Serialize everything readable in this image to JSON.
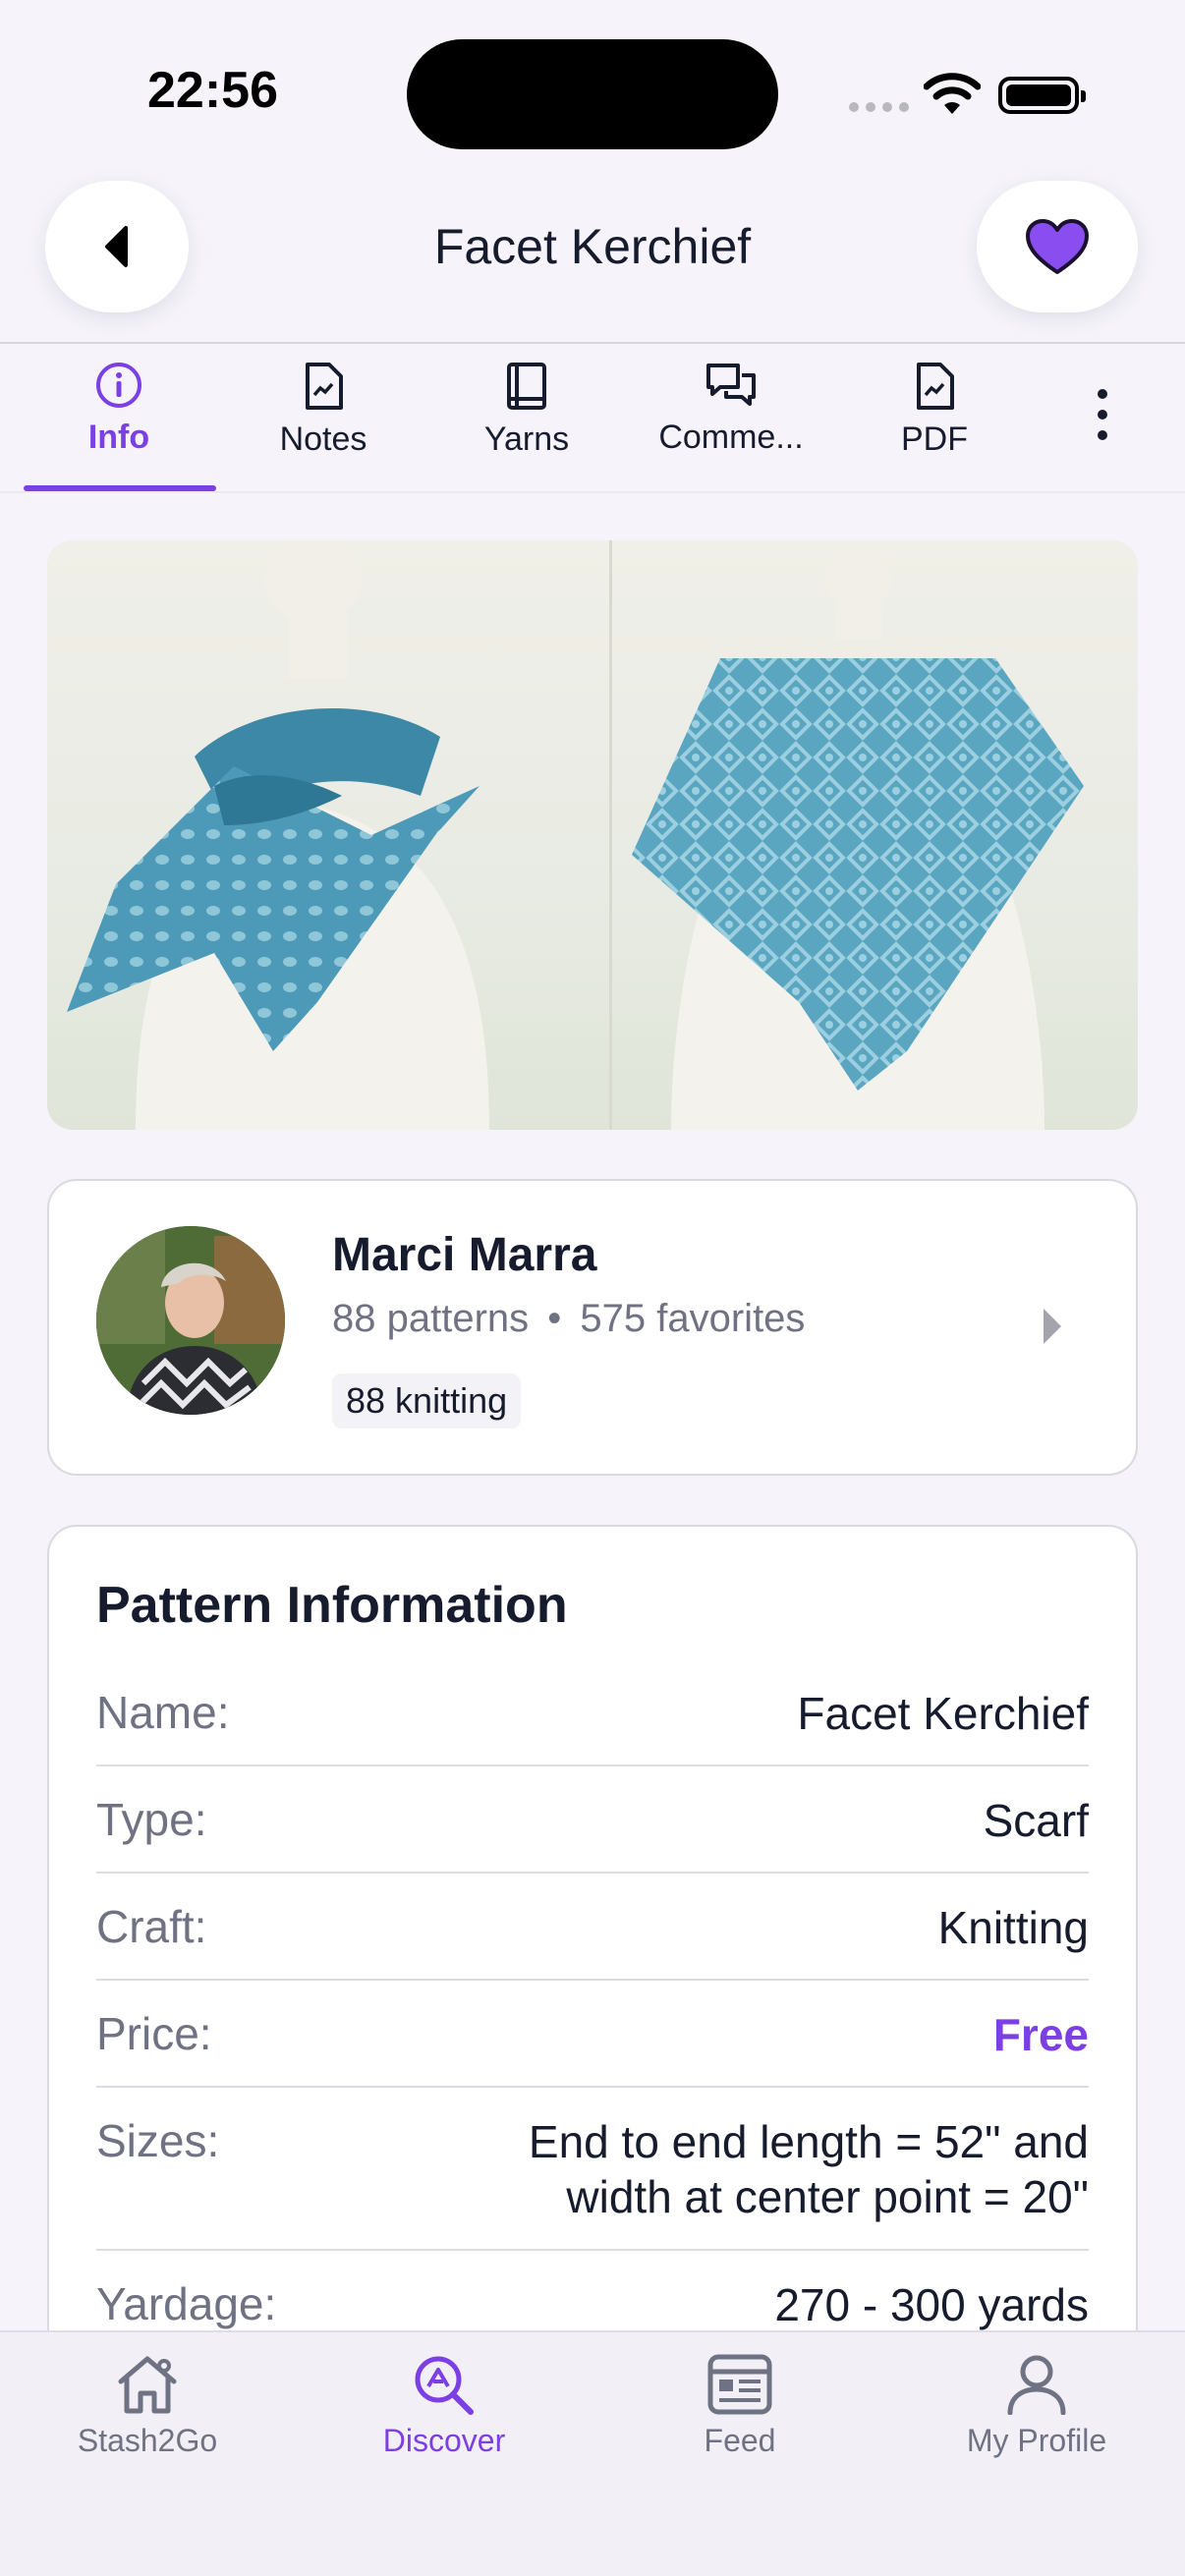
{
  "status_bar": {
    "time": "22:56"
  },
  "header": {
    "title": "Facet Kerchief"
  },
  "tabs": [
    {
      "label": "Info",
      "icon": "info-icon",
      "active": true
    },
    {
      "label": "Notes",
      "icon": "document-icon",
      "active": false
    },
    {
      "label": "Yarns",
      "icon": "book-icon",
      "active": false
    },
    {
      "label": "Comme...",
      "icon": "chat-icon",
      "active": false
    },
    {
      "label": "PDF",
      "icon": "pdf-icon",
      "active": false
    }
  ],
  "designer": {
    "name": "Marci Marra",
    "patterns": "88 patterns",
    "separator": "•",
    "favorites": "575 favorites",
    "badge": "88 knitting"
  },
  "pattern_info": {
    "title": "Pattern Information",
    "rows": [
      {
        "label": "Name:",
        "value": "Facet Kerchief"
      },
      {
        "label": "Type:",
        "value": "Scarf"
      },
      {
        "label": "Craft:",
        "value": "Knitting"
      },
      {
        "label": "Price:",
        "value": "Free"
      },
      {
        "label": "Sizes:",
        "value": "End to end length = 52\" and width at center point = 20\""
      },
      {
        "label": "Yardage:",
        "value": "270 - 300 yards"
      }
    ]
  },
  "bottom_nav": [
    {
      "label": "Stash2Go",
      "icon": "home-icon",
      "active": false
    },
    {
      "label": "Discover",
      "icon": "discover-search-icon",
      "active": true
    },
    {
      "label": "Feed",
      "icon": "feed-icon",
      "active": false
    },
    {
      "label": "My Profile",
      "icon": "profile-icon",
      "active": false
    }
  ],
  "colors": {
    "accent": "#7b3fe4",
    "heart": "#8a4df0",
    "text": "#161b2e",
    "muted": "#6f7282",
    "background": "#f6f4fa"
  }
}
